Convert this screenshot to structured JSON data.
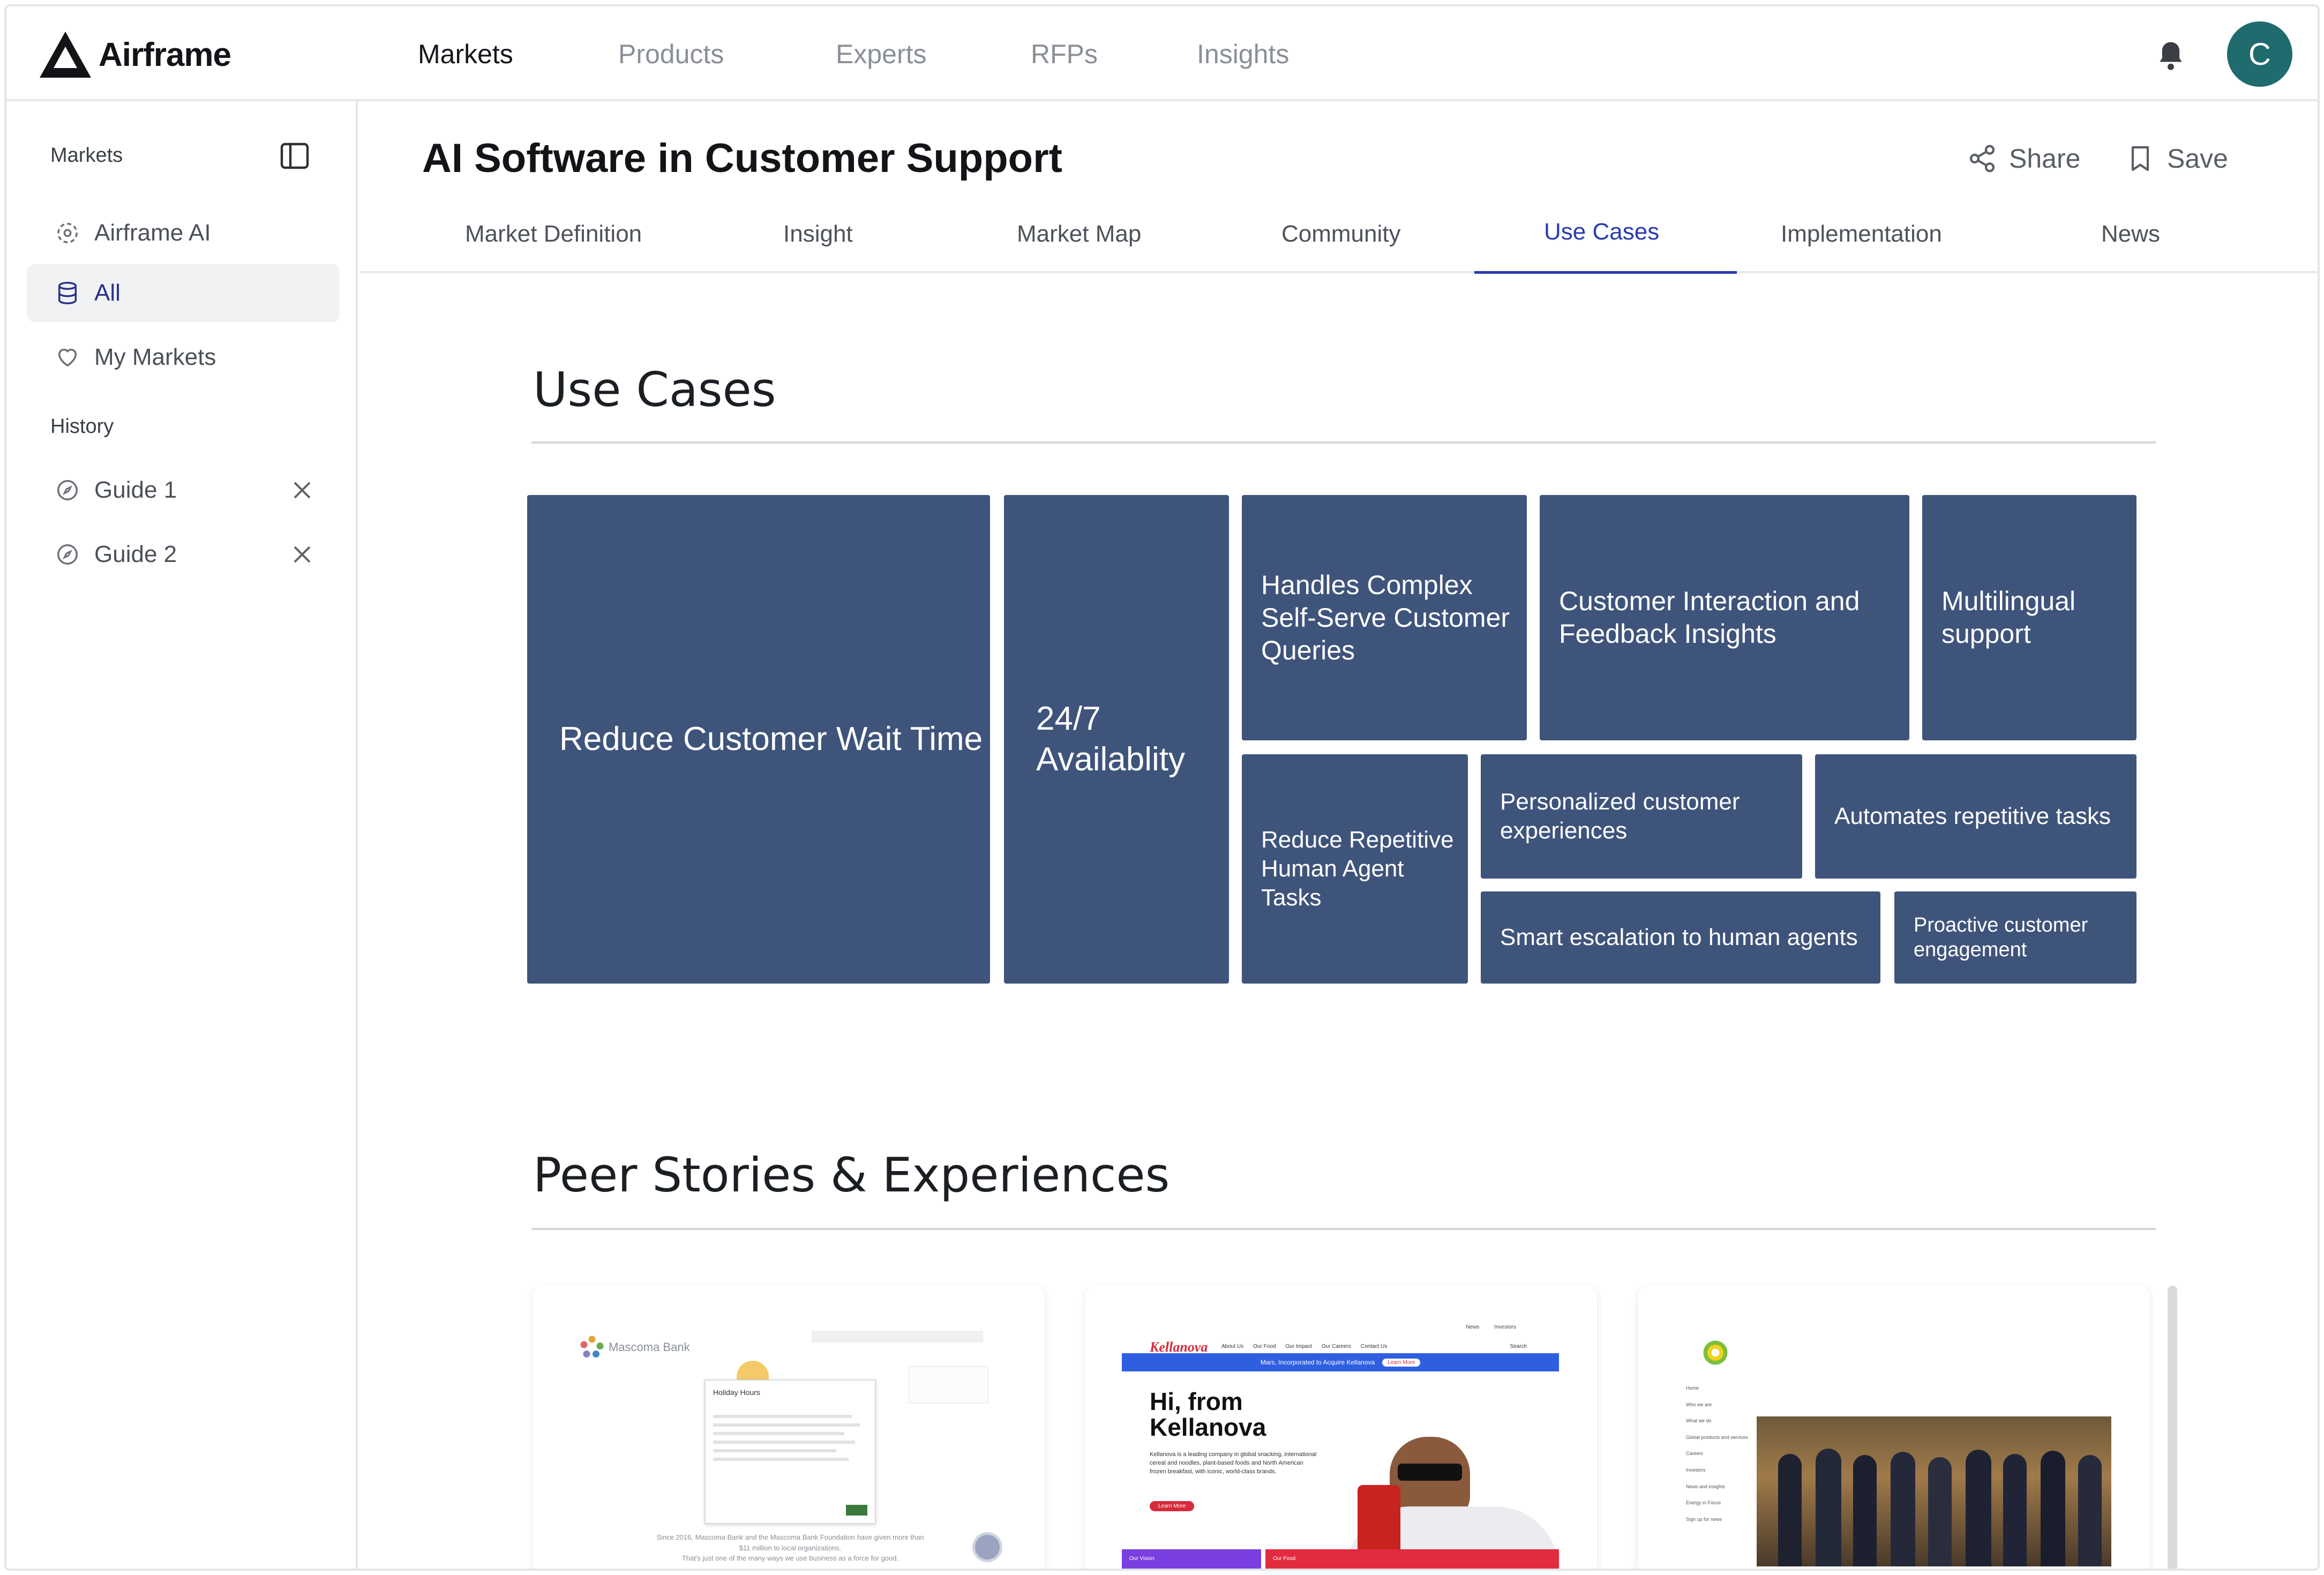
{
  "app": {
    "name": "Airframe"
  },
  "topnav": {
    "items": [
      {
        "label": "Markets",
        "active": true
      },
      {
        "label": "Products"
      },
      {
        "label": "Experts"
      },
      {
        "label": "RFPs"
      },
      {
        "label": "Insights"
      }
    ],
    "avatar_initial": "C"
  },
  "sidebar": {
    "heading": "Markets",
    "items": [
      {
        "label": "Airframe AI",
        "icon": "ai-sparkle-icon"
      },
      {
        "label": "All",
        "icon": "database-icon",
        "active": true
      },
      {
        "label": "My Markets",
        "icon": "heart-icon"
      }
    ],
    "history_heading": "History",
    "history": [
      {
        "label": "Guide 1",
        "icon": "compass-icon"
      },
      {
        "label": "Guide 2",
        "icon": "compass-icon"
      }
    ]
  },
  "page": {
    "title": "AI Software in Customer Support",
    "share_label": "Share",
    "save_label": "Save",
    "tabs": [
      {
        "label": "Market Definition"
      },
      {
        "label": "Insight"
      },
      {
        "label": "Market Map"
      },
      {
        "label": "Community"
      },
      {
        "label": "Use Cases",
        "active": true
      },
      {
        "label": "Implementation"
      },
      {
        "label": "News"
      }
    ]
  },
  "use_cases": {
    "title": "Use Cases",
    "tiles": [
      "Reduce Customer Wait Time",
      "24/7 Availablity",
      "Handles Complex Self-Serve Customer Queries",
      "Customer Interaction and Feedback Insights",
      "Multilingual support",
      "Reduce Repetitive Human Agent Tasks",
      "Personalized customer experiences",
      "Automates repetitive tasks",
      "Smart escalation to human agents",
      "Proactive customer engagement"
    ],
    "tile_color": "#3f547b"
  },
  "peer_stories": {
    "title": "Peer Stories & Experiences",
    "cards": [
      {
        "brand": "Mascoma Bank",
        "popup_title": "Holiday Hours",
        "footer": "Since 2016, Mascoma Bank and the Mascoma Bank Foundation have given more than $11 million to local organizations.",
        "footer2": "That's just one of the many ways we use business as a force for good."
      },
      {
        "brand": "Kellanova",
        "nav": [
          "About Us",
          "Our Food",
          "Our Impact",
          "Our Careers",
          "Contact Us"
        ],
        "top_links": [
          "News",
          "Investors"
        ],
        "search": "Search",
        "banner": "Mars, Incorporated to Acquire Kellanova",
        "banner_button": "Learn More",
        "headline": "Hi, from Kellanova",
        "body": "Kellanova is a leading company in global snacking, international cereal and noodles, plant-based foods and North American frozen breakfast, with iconic, world-class brands.",
        "button": "Learn More",
        "tile1": "Our Vision",
        "tile2": "Our Food"
      },
      {
        "brand": "bp",
        "menu": [
          "Home",
          "Who we are",
          "What we do",
          "Global products and services",
          "Careers",
          "Investors",
          "News and insights",
          "Energy in Focus",
          "Sign up for news"
        ]
      }
    ]
  }
}
